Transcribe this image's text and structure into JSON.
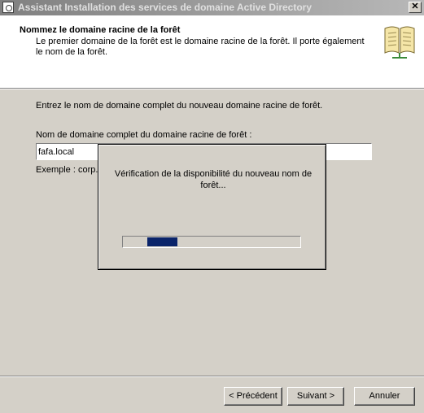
{
  "window": {
    "title": "Assistant Installation des services de domaine Active Directory",
    "close_label": "✕"
  },
  "header": {
    "title": "Nommez le domaine racine de la forêt",
    "description": "Le premier domaine de la forêt est le domaine racine de la forêt. Il porte également le nom de la forêt."
  },
  "body": {
    "instruction": "Entrez le nom de domaine complet du nouveau domaine racine de forêt.",
    "field_label": "Nom de domaine complet du domaine racine de forêt :",
    "field_value": "fafa.local",
    "example": "Exemple : corp.c"
  },
  "progress_dialog": {
    "message": "Vérification de la disponibilité du nouveau nom de forêt...",
    "progress_fraction": 0.17
  },
  "buttons": {
    "previous": "< Précédent",
    "next": "Suivant >",
    "cancel": "Annuler"
  },
  "icons": {
    "window": "server-icon",
    "header": "book-icon"
  }
}
